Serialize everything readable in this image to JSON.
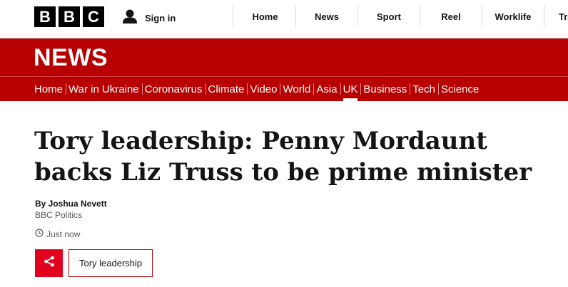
{
  "header": {
    "logo_letters": [
      "B",
      "B",
      "C"
    ],
    "signin_label": "Sign in",
    "nav_items": [
      "Home",
      "News",
      "Sport",
      "Reel",
      "Worklife",
      "Travel"
    ]
  },
  "banner": {
    "title": "NEWS"
  },
  "section_nav": {
    "items": [
      "Home",
      "War in Ukraine",
      "Coronavirus",
      "Climate",
      "Video",
      "World",
      "Asia",
      "UK",
      "Business",
      "Tech",
      "Science"
    ],
    "active": "UK"
  },
  "article": {
    "headline": "Tory leadership: Penny Mordaunt backs Liz Truss to be prime minister",
    "author": "By Joshua Nevett",
    "role": "BBC Politics",
    "timestamp": "Just now",
    "topic_tag": "Tory leadership"
  },
  "colors": {
    "brand_red": "#b80000",
    "share_red": "#e1001e"
  },
  "icons": {
    "user": "user-icon",
    "clock": "clock-icon",
    "share": "share-icon"
  }
}
